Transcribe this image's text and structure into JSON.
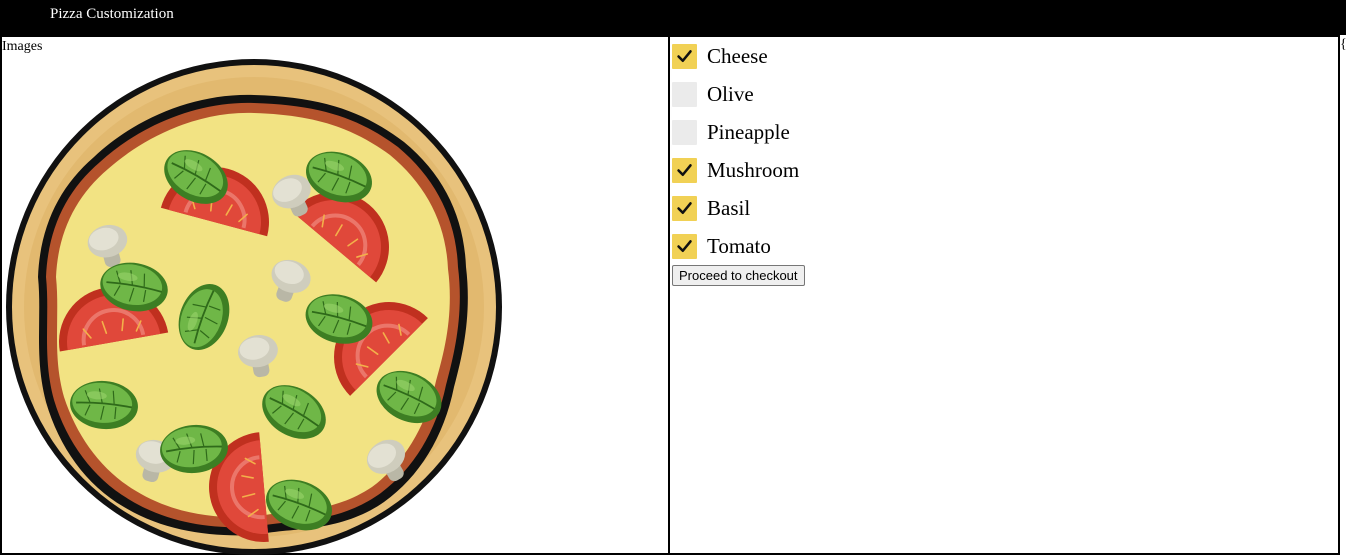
{
  "header": {
    "title": "Pizza Customization"
  },
  "left_panel": {
    "label": "Images"
  },
  "toppings": [
    {
      "label": "Cheese",
      "checked": true
    },
    {
      "label": "Olive",
      "checked": false
    },
    {
      "label": "Pineapple",
      "checked": false
    },
    {
      "label": "Mushroom",
      "checked": true
    },
    {
      "label": "Basil",
      "checked": true
    },
    {
      "label": "Tomato",
      "checked": true
    }
  ],
  "checkout_label": "Proceed to checkout",
  "edge_glyph": "{",
  "colors": {
    "header_bg": "#000000",
    "checkbox_checked": "#f1d155",
    "checkbox_unchecked": "#ebebeb",
    "cheese": "#f2e383",
    "crust": "#e8c27c",
    "sauce": "#b5532c",
    "tomato": "#d0352b",
    "basil": "#4f9a31",
    "mushroom": "#d5d3c4"
  }
}
